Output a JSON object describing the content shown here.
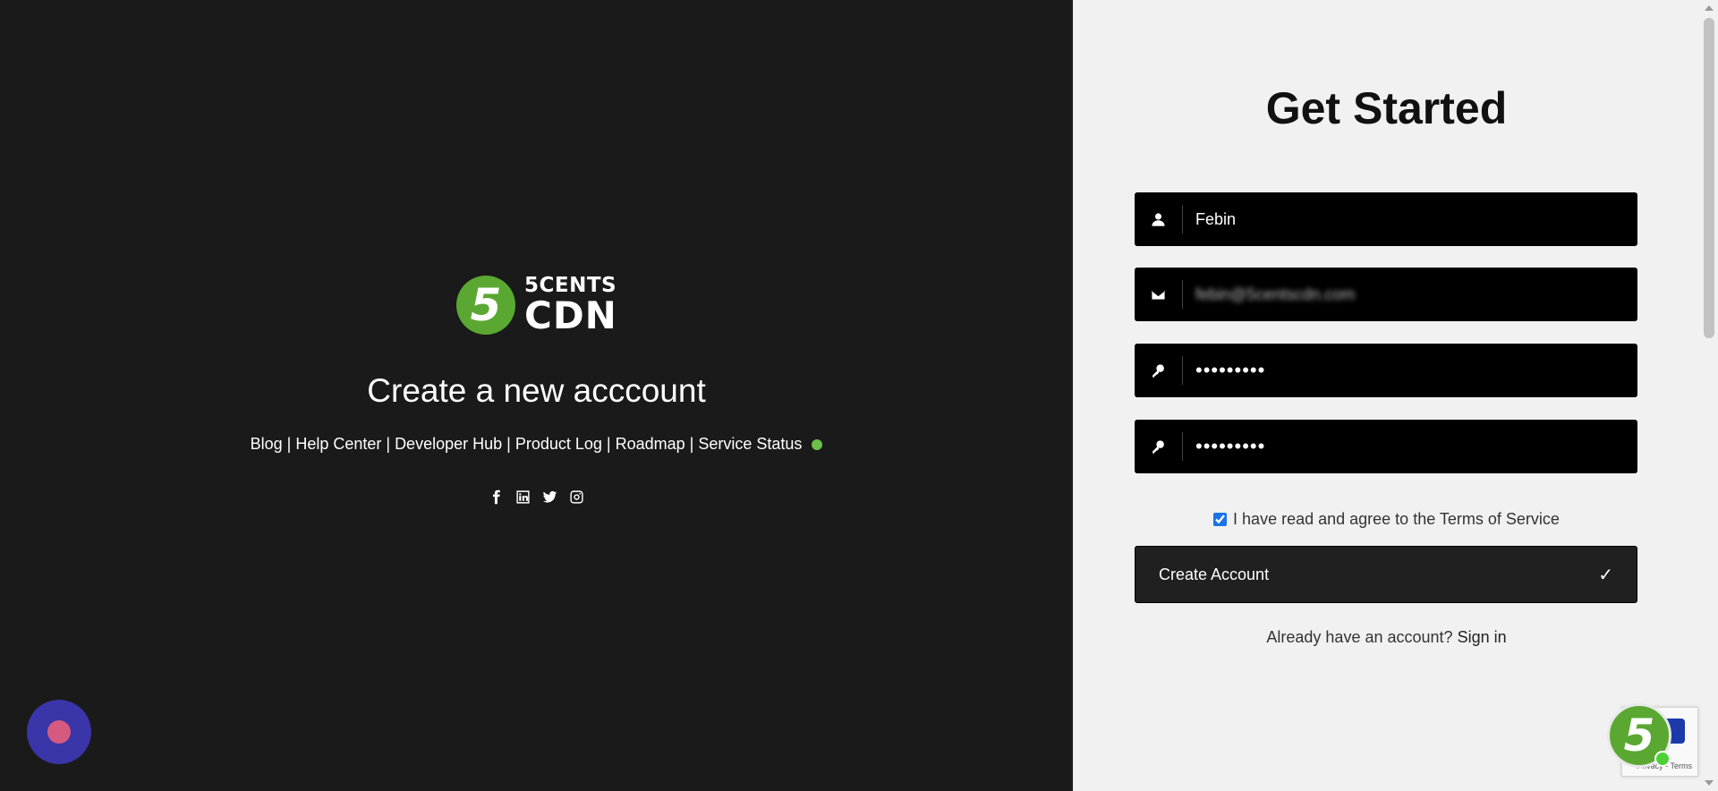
{
  "brand": {
    "badge": "5",
    "line1": "5CENTS",
    "line2": "CDN"
  },
  "left": {
    "title": "Create a new acccount",
    "links": [
      "Blog",
      "Help Center",
      "Developer Hub",
      "Product Log",
      "Roadmap",
      "Service Status"
    ],
    "separator": "|",
    "status_color": "#6cc04a",
    "social_icons": [
      "facebook-icon",
      "linkedin-icon",
      "twitter-icon",
      "instagram-icon"
    ]
  },
  "form": {
    "heading": "Get Started",
    "name_value": "Febin",
    "email_value": "febin@5centscdn.com",
    "password_value": "•••••••••",
    "confirm_value": "•••••••••",
    "terms_text": "I have read and agree to the Terms of Service",
    "submit_label": "Create Account",
    "submit_icon": "✓",
    "signin_prompt": "Already have an account?",
    "signin_link": "Sign in"
  },
  "widgets": {
    "float_badge": "5",
    "recaptcha_text": "Privacy - Terms"
  },
  "colors": {
    "left_bg": "#1a1a1a",
    "right_bg": "#f1f1f1",
    "brand_green": "#5aa832",
    "chat_bg": "#3a35a8"
  }
}
